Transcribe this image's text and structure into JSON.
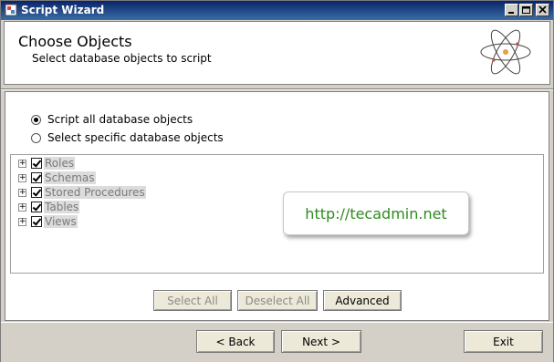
{
  "window": {
    "title": "Script Wizard"
  },
  "header": {
    "title": "Choose Objects",
    "subtitle": "Select database objects to script"
  },
  "options": {
    "script_all": "Script all database objects",
    "select_specific": "Select specific database objects",
    "selected": "script_all"
  },
  "tree": {
    "items": [
      {
        "label": "Roles",
        "checked": true
      },
      {
        "label": "Schemas",
        "checked": true
      },
      {
        "label": "Stored Procedures",
        "checked": true
      },
      {
        "label": "Tables",
        "checked": true
      },
      {
        "label": "Views",
        "checked": true
      }
    ]
  },
  "selection_buttons": {
    "select_all": "Select All",
    "deselect_all": "Deselect All",
    "advanced": "Advanced"
  },
  "nav_buttons": {
    "back": "< Back",
    "next": "Next >",
    "exit": "Exit"
  },
  "watermark": {
    "text": "http://tecadmin.net"
  },
  "colors": {
    "titlebar": "#0a246a",
    "watermark_text": "#2e8b1e"
  }
}
